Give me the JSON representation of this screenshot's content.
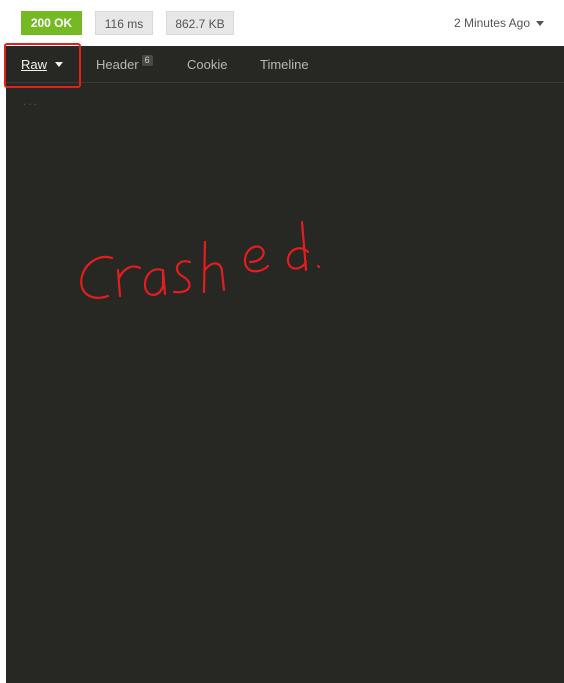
{
  "status": {
    "code_label": "200 OK",
    "time_label": "116 ms",
    "size_label": "862.7 KB",
    "history_label": "2 Minutes Ago",
    "status_color": "#75ba24"
  },
  "tabs": [
    {
      "label": "Raw"
    },
    {
      "label": "Header",
      "badge": "6"
    },
    {
      "label": "Cookie"
    },
    {
      "label": "Timeline"
    }
  ],
  "body": {
    "placeholder": "..."
  },
  "annotation": {
    "handwriting": "crashed.",
    "color": "#e21e1e"
  }
}
